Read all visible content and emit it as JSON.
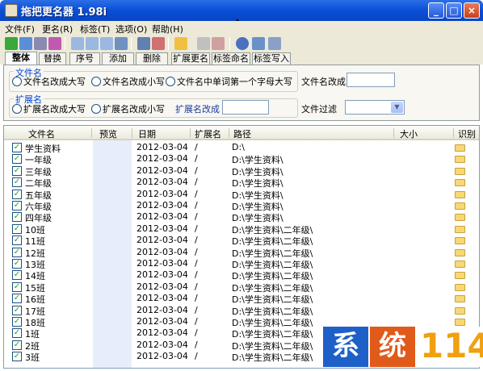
{
  "window": {
    "title": "拖把更名器 1.98i",
    "minimize": "_",
    "maximize": "□",
    "close": "×"
  },
  "menu": [
    "文件(F)",
    "更名(R)",
    "标签(T)",
    "选项(O)",
    "帮助(H)"
  ],
  "tabs": [
    "整体",
    "替换",
    "序号",
    "添加",
    "删除",
    "扩展更名",
    "标签命名",
    "标签写入"
  ],
  "options": {
    "file_group_label": "文件名",
    "file_upper": "文件名改成大写",
    "file_lower": "文件名改成小写",
    "file_word_cap": "文件名中单词第一个字母大写",
    "file_rename_label": "文件名改成",
    "file_rename_value": "",
    "ext_group_label": "扩展名",
    "ext_upper": "扩展名改成大写",
    "ext_lower": "扩展名改成小写",
    "ext_rename_label": "扩展名改成",
    "ext_rename_value": "",
    "filter_label": "文件过滤",
    "filter_value": ""
  },
  "list": {
    "columns": [
      "文件名",
      "预览",
      "日期",
      "扩展名",
      "路径",
      "大小",
      "识别"
    ],
    "rows": [
      {
        "name": "学生资料",
        "date": "2012-03-04",
        "ext": "/",
        "path": "D:\\"
      },
      {
        "name": "一年级",
        "date": "2012-03-04",
        "ext": "/",
        "path": "D:\\学生资料\\"
      },
      {
        "name": "三年级",
        "date": "2012-03-04",
        "ext": "/",
        "path": "D:\\学生资料\\"
      },
      {
        "name": "二年级",
        "date": "2012-03-04",
        "ext": "/",
        "path": "D:\\学生资料\\"
      },
      {
        "name": "五年级",
        "date": "2012-03-04",
        "ext": "/",
        "path": "D:\\学生资料\\"
      },
      {
        "name": "六年级",
        "date": "2012-03-04",
        "ext": "/",
        "path": "D:\\学生资料\\"
      },
      {
        "name": "四年级",
        "date": "2012-03-04",
        "ext": "/",
        "path": "D:\\学生资料\\"
      },
      {
        "name": "10班",
        "date": "2012-03-04",
        "ext": "/",
        "path": "D:\\学生资料\\二年级\\"
      },
      {
        "name": "11班",
        "date": "2012-03-04",
        "ext": "/",
        "path": "D:\\学生资料\\二年级\\"
      },
      {
        "name": "12班",
        "date": "2012-03-04",
        "ext": "/",
        "path": "D:\\学生资料\\二年级\\"
      },
      {
        "name": "13班",
        "date": "2012-03-04",
        "ext": "/",
        "path": "D:\\学生资料\\二年级\\"
      },
      {
        "name": "14班",
        "date": "2012-03-04",
        "ext": "/",
        "path": "D:\\学生资料\\二年级\\"
      },
      {
        "name": "15班",
        "date": "2012-03-04",
        "ext": "/",
        "path": "D:\\学生资料\\二年级\\"
      },
      {
        "name": "16班",
        "date": "2012-03-04",
        "ext": "/",
        "path": "D:\\学生资料\\二年级\\"
      },
      {
        "name": "17班",
        "date": "2012-03-04",
        "ext": "/",
        "path": "D:\\学生资料\\二年级\\"
      },
      {
        "name": "18班",
        "date": "2012-03-04",
        "ext": "/",
        "path": "D:\\学生资料\\二年级\\"
      },
      {
        "name": "1班",
        "date": "2012-03-04",
        "ext": "/",
        "path": "D:\\学生资料\\二年级\\"
      },
      {
        "name": "2班",
        "date": "2012-03-04",
        "ext": "/",
        "path": "D:\\学生资料\\二年级\\"
      },
      {
        "name": "3班",
        "date": "2012-03-04",
        "ext": "/",
        "path": "D:\\学生资料\\二年级\\"
      }
    ]
  },
  "watermark": [
    "系",
    "统",
    "114"
  ]
}
